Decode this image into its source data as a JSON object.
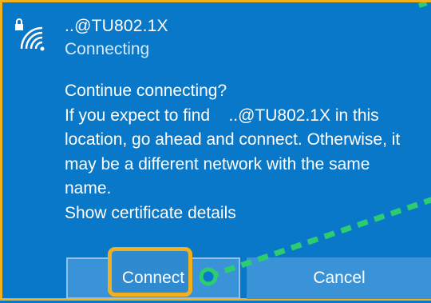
{
  "network": {
    "ssid": "..@TU802.1X",
    "status": "Connecting"
  },
  "message": {
    "lines": [
      "Continue connecting?",
      "If you expect to find    ..@TU802.1X in this",
      "location, go ahead and connect. Otherwise, it",
      "may be a different network with the same",
      "name."
    ],
    "cert_link": "Show certificate details"
  },
  "buttons": {
    "connect_label": "Connect",
    "cancel_label": "Cancel"
  },
  "icons": {
    "wifi": "wifi-secured-icon"
  },
  "colors": {
    "background": "#0a78c8",
    "button": "#3a93d6",
    "highlight": "#f2b01e",
    "annotation": "#2ecc71"
  }
}
